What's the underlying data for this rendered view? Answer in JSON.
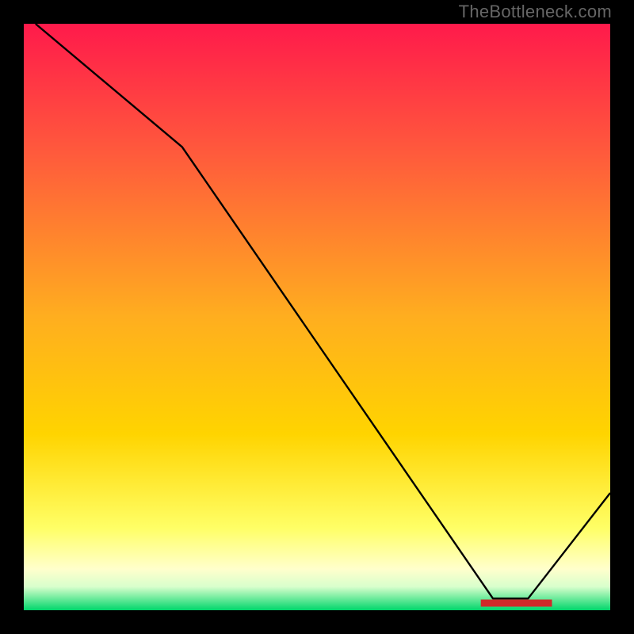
{
  "watermark": "TheBottleneck.com",
  "colors": {
    "top": "#ff1a4b",
    "mid": "#ffd400",
    "low1": "#ffff66",
    "low2": "#ffffcc",
    "bottom": "#00d66b",
    "line": "#000000",
    "marker": "#d02a2a",
    "frame": "#000000"
  },
  "chart_data": {
    "type": "line",
    "title": "",
    "xlabel": "",
    "ylabel": "",
    "xlim": [
      0,
      100
    ],
    "ylim": [
      0,
      100
    ],
    "x": [
      2,
      27,
      80,
      86,
      100
    ],
    "values": [
      100,
      79,
      2,
      2,
      20
    ],
    "minimum_x_range": [
      78,
      90
    ],
    "notes": "Gradient background red→yellow→pale→green top to bottom; black curve descends from top-left, kinks near x≈27, reaches bottom near x≈80–86 (red marker strip), then rises to lower-right corner."
  }
}
